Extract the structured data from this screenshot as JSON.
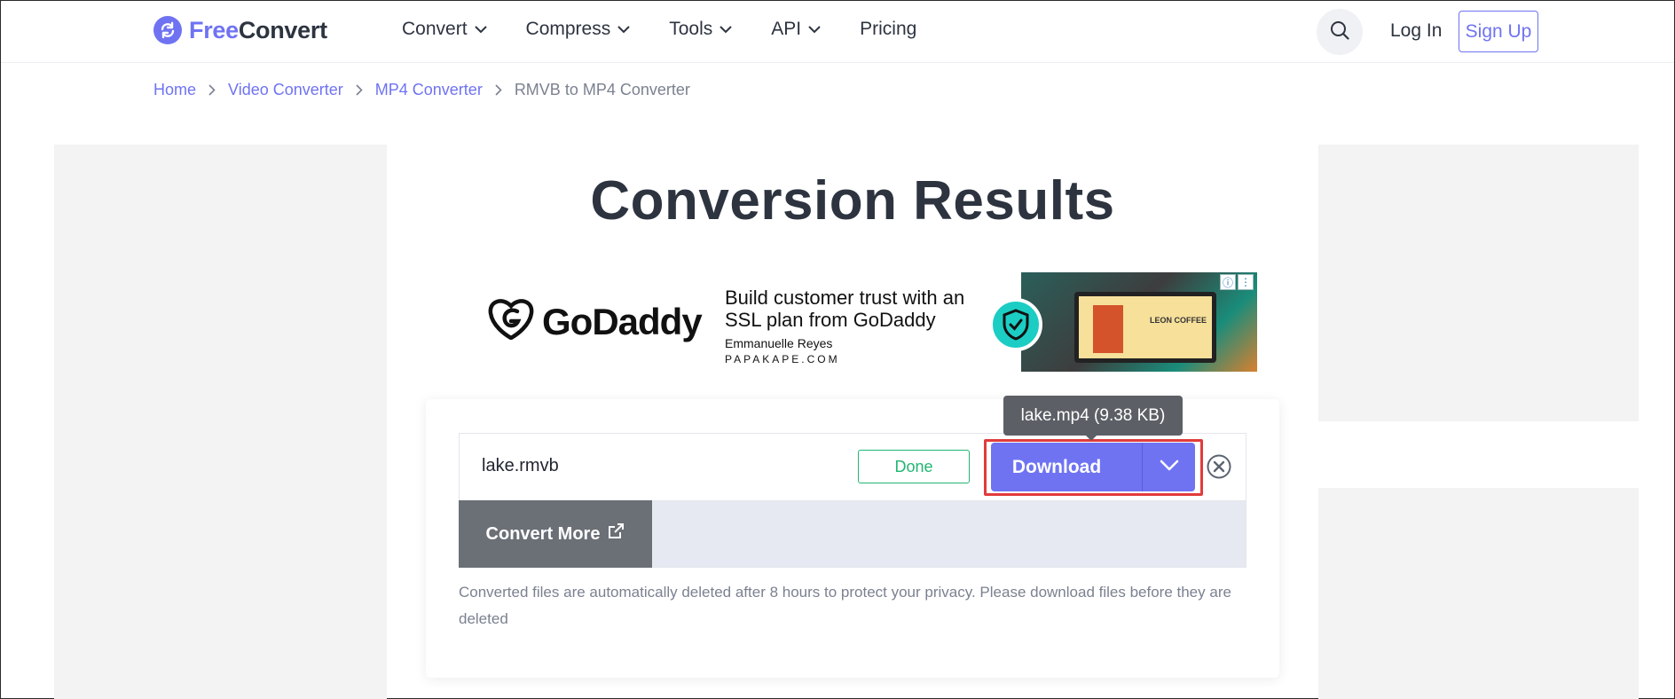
{
  "header": {
    "logo": {
      "free": "Free",
      "convert": "Convert"
    },
    "nav": [
      {
        "label": "Convert",
        "has_menu": true
      },
      {
        "label": "Compress",
        "has_menu": true
      },
      {
        "label": "Tools",
        "has_menu": true
      },
      {
        "label": "API",
        "has_menu": true
      },
      {
        "label": "Pricing",
        "has_menu": false
      }
    ],
    "search_icon": "search-icon",
    "login_label": "Log In",
    "signup_label": "Sign Up"
  },
  "breadcrumb": {
    "items": [
      "Home",
      "Video Converter",
      "MP4 Converter"
    ],
    "current": "RMVB to MP4 Converter"
  },
  "page": {
    "title": "Conversion Results"
  },
  "ad": {
    "brand": "GoDaddy",
    "headline": "Build customer trust with an SSL plan from GoDaddy",
    "person": "Emmanuelle Reyes",
    "site": "PAPAKAPE.COM",
    "image_text": "LEON COFFEE"
  },
  "result": {
    "file_name": "lake.rmvb",
    "status": "Done",
    "download_label": "Download",
    "tooltip": "lake.mp4 (9.38 KB)",
    "convert_more_label": "Convert More",
    "privacy_note": "Converted files are automatically deleted after 8 hours to protect your privacy. Please download files before they are deleted"
  },
  "colors": {
    "brand": "#6f73f2",
    "success": "#22b573",
    "highlight": "#e23b3b",
    "text": "#2d3440",
    "muted": "#7b8190"
  }
}
